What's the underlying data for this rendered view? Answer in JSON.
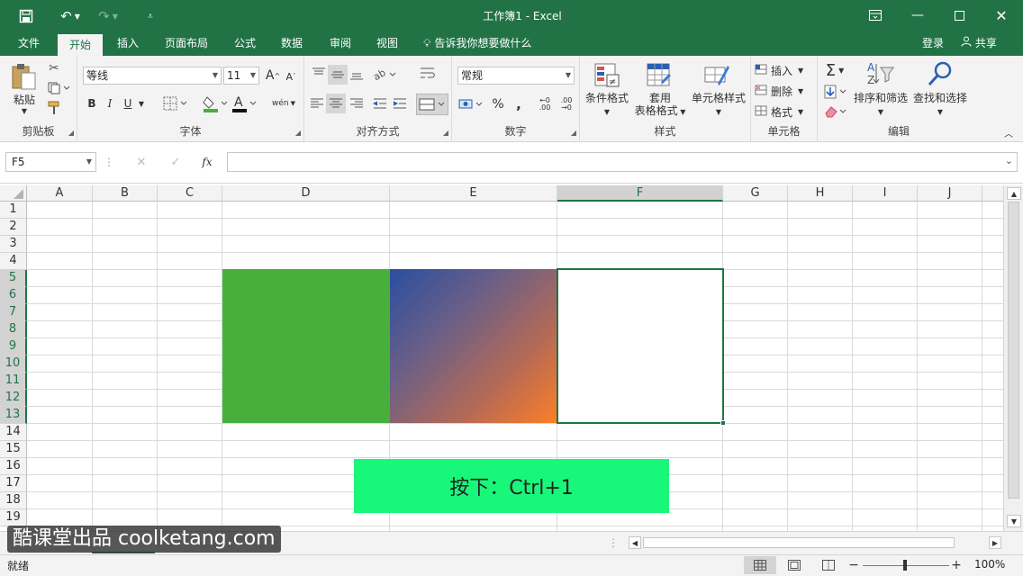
{
  "window": {
    "title": "工作簿1 - Excel"
  },
  "tabs": [
    {
      "label": "文件",
      "active": false
    },
    {
      "label": "开始",
      "active": true
    },
    {
      "label": "插入",
      "active": false
    },
    {
      "label": "页面布局",
      "active": false
    },
    {
      "label": "公式",
      "active": false
    },
    {
      "label": "数据",
      "active": false
    },
    {
      "label": "审阅",
      "active": false
    },
    {
      "label": "视图",
      "active": false
    }
  ],
  "tell_me": "告诉我你想要做什么",
  "account": {
    "login": "登录",
    "share": "共享"
  },
  "ribbon": {
    "clipboard": {
      "paste": "粘贴",
      "label": "剪贴板"
    },
    "font": {
      "name": "等线",
      "size": "11",
      "bold": "B",
      "italic": "I",
      "underline": "U",
      "wen": "wén",
      "label": "字体"
    },
    "alignment": {
      "label": "对齐方式"
    },
    "number": {
      "format": "常规",
      "label": "数字"
    },
    "styles": {
      "conditional": "条件格式",
      "table_line1": "套用",
      "table_line2": "表格格式",
      "cell_styles": "单元格样式",
      "label": "样式"
    },
    "cells": {
      "insert": "插入",
      "delete": "删除",
      "format": "格式",
      "label": "单元格"
    },
    "editing": {
      "sort": "排序和筛选",
      "find": "查找和选择",
      "label": "编辑"
    }
  },
  "formula_bar": {
    "name_box": "F5",
    "fx": "fx",
    "value": ""
  },
  "grid": {
    "columns": [
      "A",
      "B",
      "C",
      "D",
      "E",
      "F",
      "G",
      "H",
      "I",
      "J"
    ],
    "rows": [
      "1",
      "2",
      "3",
      "4",
      "5",
      "6",
      "7",
      "8",
      "9",
      "10",
      "11",
      "12",
      "13",
      "14",
      "15",
      "16",
      "17",
      "18",
      "19"
    ],
    "selected_column": "F",
    "selected_rows": [
      "5",
      "13"
    ],
    "fills": {
      "D5:D13": {
        "type": "solid",
        "color": "#47b03c"
      },
      "E5:E13": {
        "type": "gradient",
        "colors": [
          "#2b4ea0",
          "#fc7f26"
        ]
      }
    }
  },
  "overlay_hint": "按下：Ctrl+1",
  "watermark": "酷课堂出品 coolketang.com",
  "status": {
    "ready": "就绪",
    "zoom": "100%"
  }
}
